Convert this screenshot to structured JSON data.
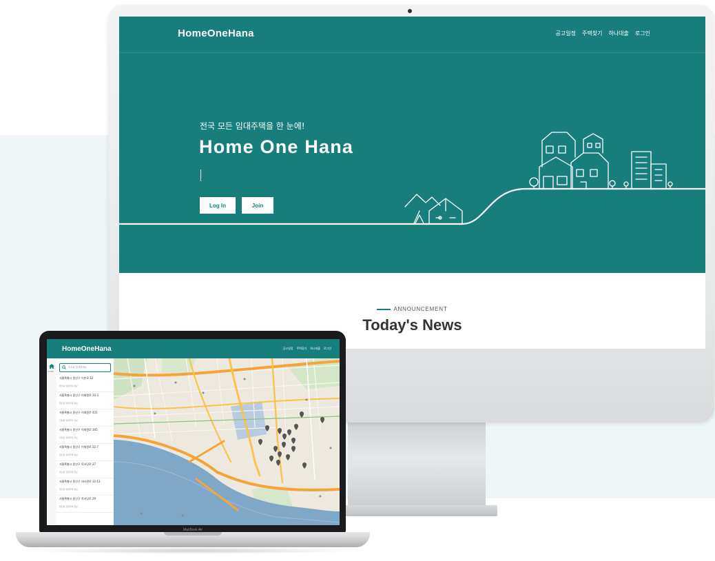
{
  "desktop": {
    "brand": "HomeOneHana",
    "nav": [
      "공고일정",
      "주택찾기",
      "하나대출",
      "로그인"
    ],
    "hero": {
      "subtitle": "전국 모든 임대주택을 한 눈에!",
      "title": "Home One Hana",
      "login_label": "Log In",
      "join_label": "Join"
    },
    "section_label": "ANNOUNCEMENT",
    "section_title": "Today's News"
  },
  "laptop": {
    "brand": "HomeOneHana",
    "nav": [
      "공고일정",
      "주택찾기",
      "하나대출",
      "로그인"
    ],
    "rail_label": "HOME",
    "search_placeholder": "주소로 검색하세요",
    "listings": [
      {
        "title": "서울특별시 용산구 이촌로 12",
        "sub": "행신동 임대주택 정보"
      },
      {
        "title": "서울특별시 용산구 이태원로 10-3",
        "sub": "행신동 임대주택 정보"
      },
      {
        "title": "서울특별시 용산구 이태원로 431",
        "sub": "한남동 임대주택 정보"
      },
      {
        "title": "서울특별시 용산구 이태원로 345",
        "sub": "한남동 임대주택 정보"
      },
      {
        "title": "서울특별시 용산구 이태원로 22-7",
        "sub": "행신동 임대주택 정보"
      },
      {
        "title": "서울특별시 용산구 독서당로 27",
        "sub": "행신동 임대주택 정보"
      },
      {
        "title": "서울특별시 용산구 대사관로 32-13",
        "sub": "행신동 임대주택 정보"
      },
      {
        "title": "서울특별시 용산구 독서당로 29",
        "sub": "행신동 임대주택 정보"
      }
    ],
    "model_label": "MacBook Air"
  },
  "colors": {
    "brand_teal": "#177e7b",
    "background_tint": "#eef6f7",
    "map_river": "#7fa7c7",
    "map_land": "#ede9df"
  }
}
